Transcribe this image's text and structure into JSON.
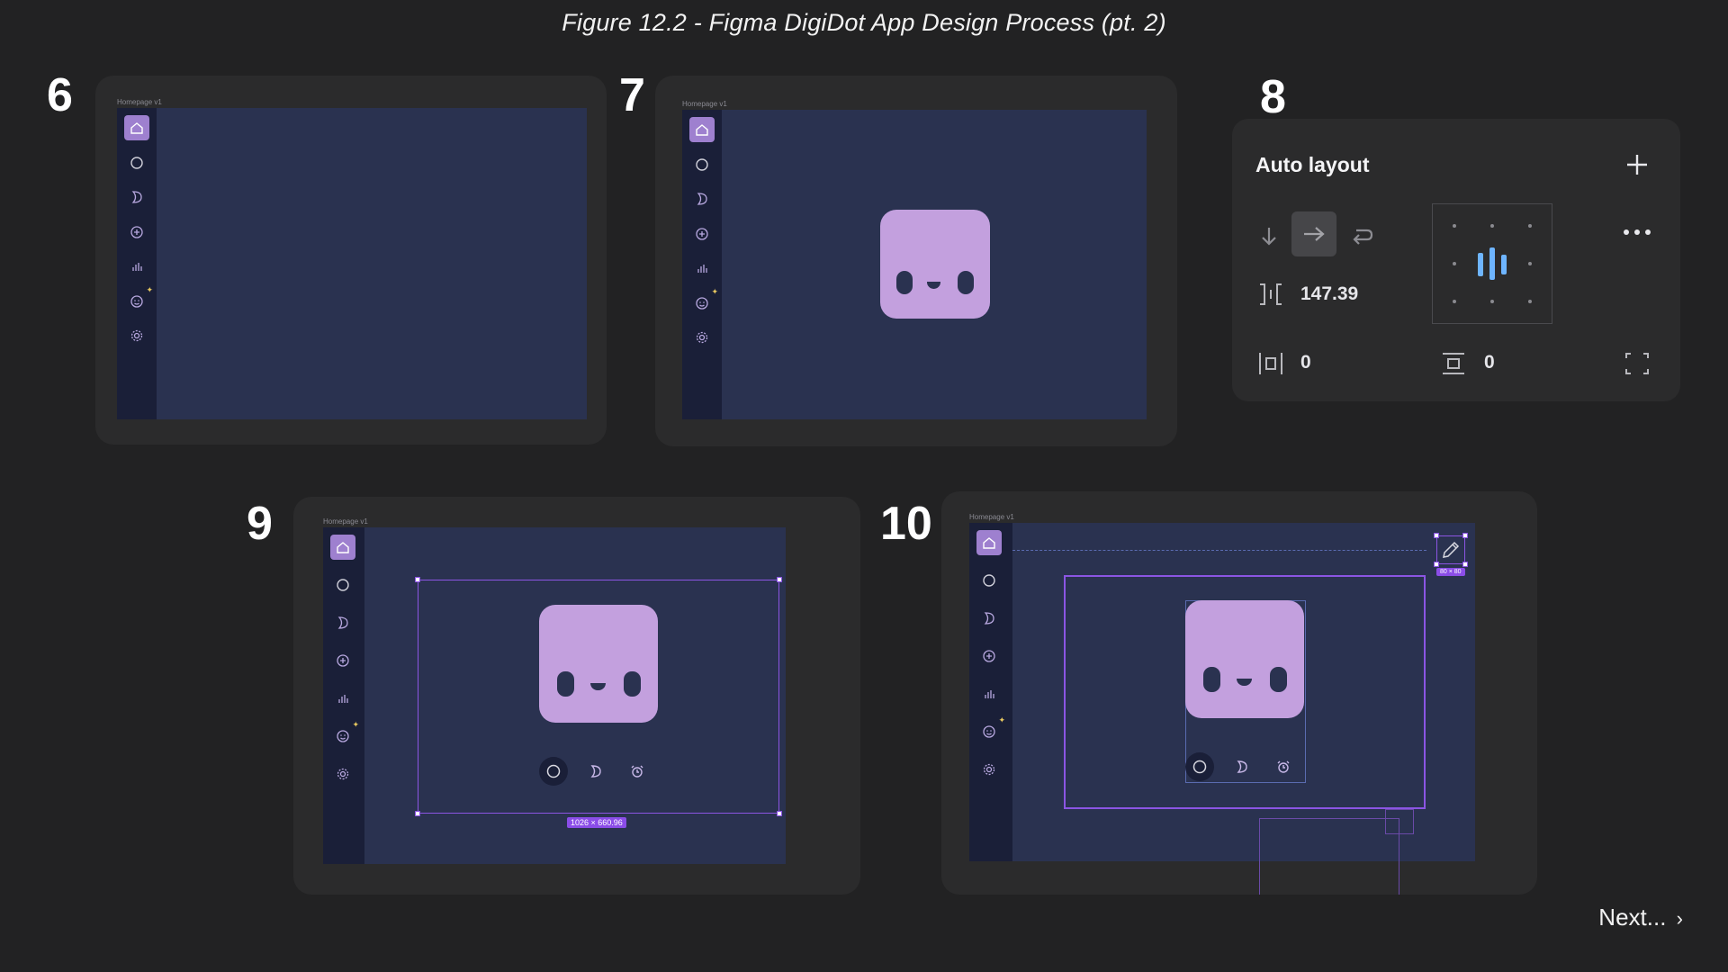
{
  "figure_title": "Figure 12.2 - Figma DigiDot App Design Process (pt. 2)",
  "steps": {
    "s6": {
      "number": "6",
      "frame_label": "Homepage v1"
    },
    "s7": {
      "number": "7",
      "frame_label": "Homepage v1"
    },
    "s8": {
      "number": "8",
      "panel_title": "Auto layout",
      "gap_value": "147.39",
      "padding_horizontal": "0",
      "padding_vertical": "0"
    },
    "s9": {
      "number": "9",
      "frame_label": "Homepage v1",
      "selection_size": "1026 × 660.96"
    },
    "s10": {
      "number": "10",
      "frame_label": "Homepage v1",
      "icon_size": "80 × 80"
    }
  },
  "sidebar_icons": [
    "home-icon",
    "circle-icon",
    "moon-icon",
    "plus-circle-icon",
    "bar-chart-icon",
    "smiley-icon",
    "settings-icon"
  ],
  "bottom_nav_icons": [
    "circle-icon",
    "moon-icon",
    "alarm-icon"
  ],
  "colors": {
    "background": "#222223",
    "card": "#2b2b2c",
    "canvas": "#2a3250",
    "sidebar": "#1a1f38",
    "active_icon": "#9e80cf",
    "bot": "#c3a0de",
    "selection": "#8b55e3",
    "align_accent": "#6eb5ff"
  },
  "next_label": "Next..."
}
